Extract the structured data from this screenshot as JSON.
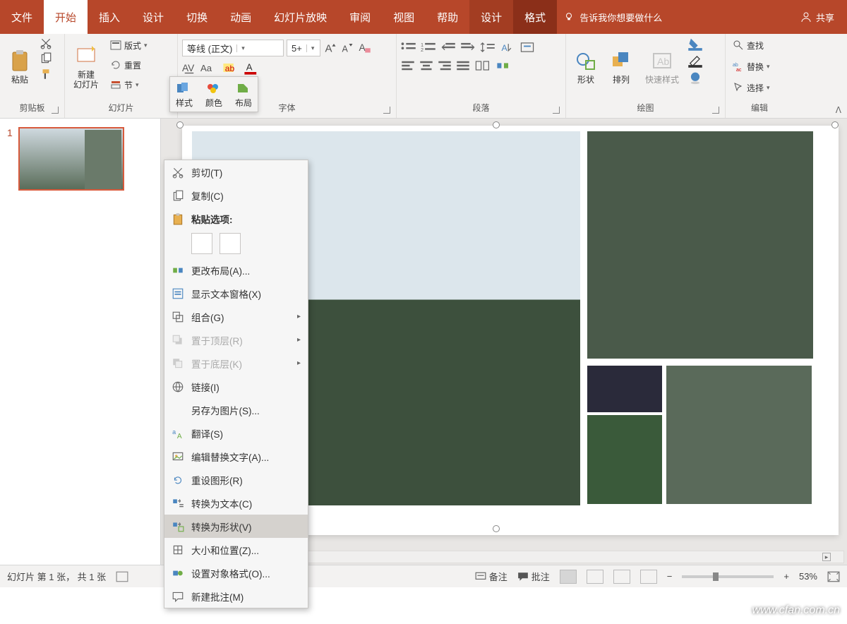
{
  "tabs": {
    "file": "文件",
    "home": "开始",
    "insert": "插入",
    "design": "设计",
    "transitions": "切换",
    "animations": "动画",
    "slideshow": "幻灯片放映",
    "review": "审阅",
    "view": "视图",
    "help": "帮助",
    "ctx_design": "设计",
    "ctx_format": "格式",
    "tell_me": "告诉我你想要做什么",
    "share": "共享"
  },
  "ribbon": {
    "clipboard": {
      "paste": "粘贴",
      "label": "剪贴板"
    },
    "slides": {
      "new_slide": "新建\n幻灯片",
      "layout": "版式",
      "reset": "重置",
      "section": "节",
      "label": "幻灯片"
    },
    "font": {
      "name": "等线 (正文)",
      "size": "5+",
      "label": "字体"
    },
    "paragraph": {
      "label": "段落"
    },
    "drawing": {
      "shapes": "形状",
      "arrange": "排列",
      "quick": "快速样式",
      "label": "绘图"
    },
    "editing": {
      "find": "查找",
      "replace": "替换",
      "select": "选择",
      "label": "编辑"
    }
  },
  "smartart_popup": {
    "styles": "样式",
    "colors": "颜色",
    "layouts": "布局"
  },
  "thumbnails": {
    "slide1_num": "1"
  },
  "context_menu": {
    "cut": "剪切(T)",
    "copy": "复制(C)",
    "paste_options": "粘贴选项:",
    "change_layout": "更改布局(A)...",
    "show_text_pane": "显示文本窗格(X)",
    "group": "组合(G)",
    "bring_front": "置于顶层(R)",
    "send_back": "置于底层(K)",
    "link": "链接(I)",
    "save_as_picture": "另存为图片(S)...",
    "translate": "翻译(S)",
    "alt_text": "编辑替换文字(A)...",
    "reset_graphic": "重设图形(R)",
    "convert_to_text": "转换为文本(C)",
    "convert_to_shapes": "转换为形状(V)",
    "size_position": "大小和位置(Z)...",
    "format_object": "设置对象格式(O)...",
    "new_comment": "新建批注(M)"
  },
  "statusbar": {
    "slide_info": "幻灯片 第 1 张， 共 1 张",
    "notes": "备注",
    "comments": "批注",
    "zoom": "53%"
  },
  "watermark": "www.cfan.com.cn"
}
